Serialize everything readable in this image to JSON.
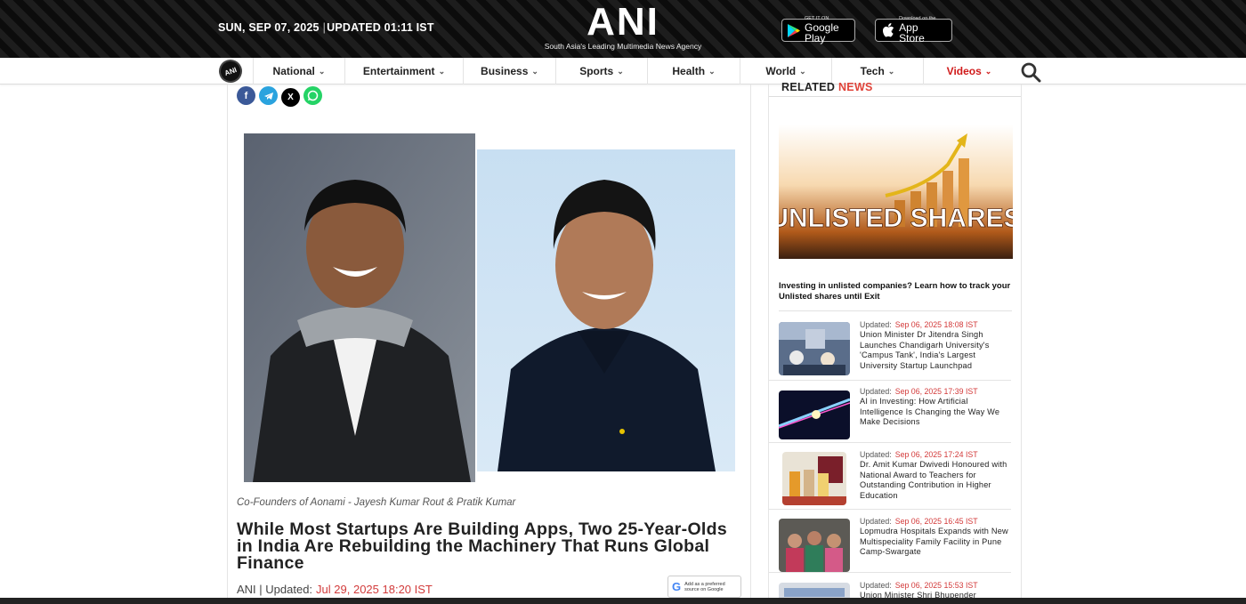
{
  "header": {
    "date": "SUN, SEP 07, 2025",
    "updated": "UPDATED 01:11 IST",
    "logo": "ANI",
    "tagline": "South Asia's Leading Multimedia News Agency",
    "google_play": {
      "small": "GET IT ON",
      "big": "Google Play"
    },
    "app_store": {
      "small": "Download on the",
      "big": "App Store"
    }
  },
  "nav": {
    "items": [
      {
        "label": "National"
      },
      {
        "label": "Entertainment"
      },
      {
        "label": "Business"
      },
      {
        "label": "Sports"
      },
      {
        "label": "Health"
      },
      {
        "label": "World"
      },
      {
        "label": "Tech"
      },
      {
        "label": "Videos"
      }
    ]
  },
  "article": {
    "share": {
      "facebook": "f",
      "x": "X"
    },
    "caption": "Co-Founders of Aonami - Jayesh Kumar Rout & Pratik Kumar",
    "headline": "While Most Startups Are Building Apps, Two 25-Year-Olds in India Are Rebuilding the Machinery That Runs Global Finance",
    "source": "ANI | Updated:",
    "timestamp": "Jul 29, 2025 18:20 IST",
    "google_button": {
      "line1": "Add as a preferred",
      "line2": "source on Google"
    }
  },
  "sidebar": {
    "title_main": "RELATED",
    "title_accent": "NEWS",
    "promo": {
      "image_text": "UNLISTED SHARES",
      "text": "Investing in unlisted companies? Learn how to track your Unlisted shares until Exit"
    },
    "news": [
      {
        "updated_label": "Updated:",
        "time": "Sep 06, 2025 18:08 IST",
        "title": "Union Minister Dr Jitendra Singh Launches Chandigarh University's 'Campus Tank', India's Largest University Startup Launchpad"
      },
      {
        "updated_label": "Updated:",
        "time": "Sep 06, 2025 17:39 IST",
        "title": "AI in Investing: How Artificial Intelligence Is Changing the Way We Make Decisions"
      },
      {
        "updated_label": "Updated:",
        "time": "Sep 06, 2025 17:24 IST",
        "title": "Dr. Amit Kumar Dwivedi Honoured with National Award to Teachers for Outstanding Contribution in Higher Education"
      },
      {
        "updated_label": "Updated:",
        "time": "Sep 06, 2025 16:45 IST",
        "title": "Lopmudra Hospitals Expands with New Multispeciality Family Facility in Pune Camp-Swargate"
      },
      {
        "updated_label": "Updated:",
        "time": "Sep 06, 2025 15:53 IST",
        "title": "Union Minister Shri Bhupender"
      }
    ]
  }
}
